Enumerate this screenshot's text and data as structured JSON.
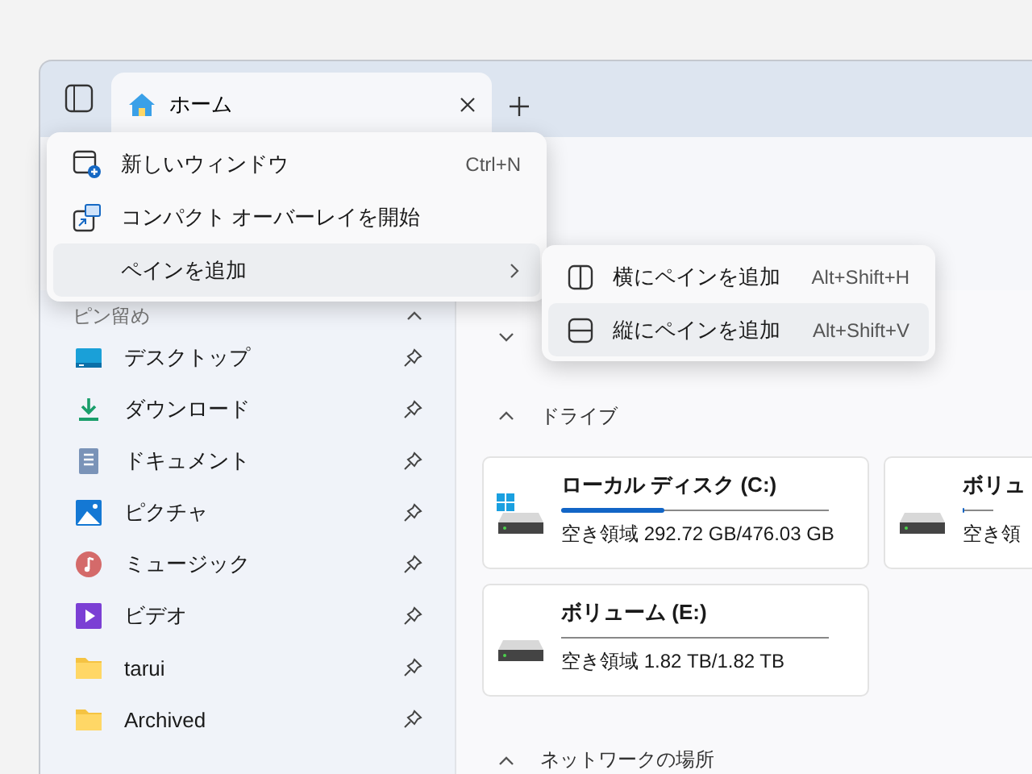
{
  "tab": {
    "title": "ホーム",
    "selected": true
  },
  "menu": {
    "items": [
      {
        "kind": "new-window",
        "label": "新しいウィンドウ",
        "shortcut": "Ctrl+N",
        "selected": false,
        "submenu": false
      },
      {
        "kind": "compact",
        "label": "コンパクト オーバーレイを開始",
        "selected": false,
        "submenu": false
      },
      {
        "kind": "none",
        "label": "ペインを追加",
        "selected": true,
        "submenu": true
      }
    ]
  },
  "submenu": {
    "items": [
      {
        "kind": "split-h",
        "label": "横にペインを追加",
        "shortcut": "Alt+Shift+H",
        "selected": false
      },
      {
        "kind": "split-v",
        "label": "縦にペインを追加",
        "shortcut": "Alt+Shift+V",
        "selected": true
      }
    ]
  },
  "sidebar": {
    "title": "ピン留め",
    "expanded": true,
    "items": [
      {
        "kind": "desktop",
        "label": "デスクトップ"
      },
      {
        "kind": "download",
        "label": "ダウンロード"
      },
      {
        "kind": "document",
        "label": "ドキュメント"
      },
      {
        "kind": "picture",
        "label": "ピクチャ"
      },
      {
        "kind": "music",
        "label": "ミュージック"
      },
      {
        "kind": "video",
        "label": "ビデオ"
      },
      {
        "kind": "folder",
        "label": "tarui"
      },
      {
        "kind": "folder",
        "label": "Archived"
      }
    ]
  },
  "sections": [
    {
      "kind": "hidden",
      "expanded": false
    },
    {
      "kind": "drives",
      "title": "ドライブ",
      "expanded": true,
      "drives": [
        {
          "name": "ローカル ディスク (C:)",
          "free": "空き領域 292.72 GB/476.03 GB",
          "level": 0.385,
          "system": true
        },
        {
          "name": "ボリュ",
          "free": "空き領",
          "level": 0.01,
          "system": false
        },
        {
          "name": "ボリューム (E:)",
          "free": "空き領域 1.82 TB/1.82 TB",
          "level": 0,
          "system": false
        }
      ]
    },
    {
      "kind": "network",
      "title": "ネットワークの場所",
      "expanded": true
    }
  ]
}
